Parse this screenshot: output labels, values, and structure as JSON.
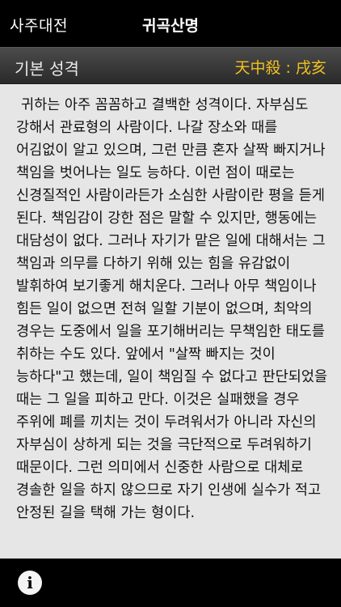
{
  "nav": {
    "back_label": "사주대전",
    "title": "귀곡산명"
  },
  "section": {
    "title": "기본 성격",
    "ganji": "天中殺 : 戌亥"
  },
  "content": {
    "text": "귀하는 아주 꼼꼼하고 결백한 성격이다. 자부심도 강해서 관료형의 사람이다. 나갈 장소와 때를 어김없이 알고 있으며, 그런 만큼 혼자 살짝 빠지거나 책임을 벗어나는 일도 능하다. 이런 점이 때로는 신경질적인 사람이라든가 소심한 사람이란 평을 듣게 된다. 책임감이 강한 점은 말할 수 있지만, 행동에는 대담성이 없다. 그러나 자기가 맡은 일에 대해서는 그 책임과 의무를 다하기 위해 있는 힘을 유감없이 발휘하여 보기좋게 해치운다. 그러나 아무 책임이나 힘든 일이 없으면 전혀 일할 기분이 없으며, 최악의 경우는 도중에서 일을 포기해버리는 무책임한 태도를 취하는 수도 있다. 앞에서 \"살짝 빠지는 것이 능하다\"고 했는데, 일이 책임질 수 없다고 판단되었을 때는 그 일을 피하고 만다. 이것은 실패했을 경우 주위에 폐를 끼치는 것이 두려워서가 아니라 자신의 자부심이 상하게 되는 것을 극단적으로 두려워하기 때문이다. 그런 의미에서 신중한 사람으로 대체로 경솔한 일을 하지 않으므로 자기 인생에 실수가 적고 안정된 길을 택해 가는 형이다."
  },
  "toolbar": {
    "info_glyph": "i"
  }
}
